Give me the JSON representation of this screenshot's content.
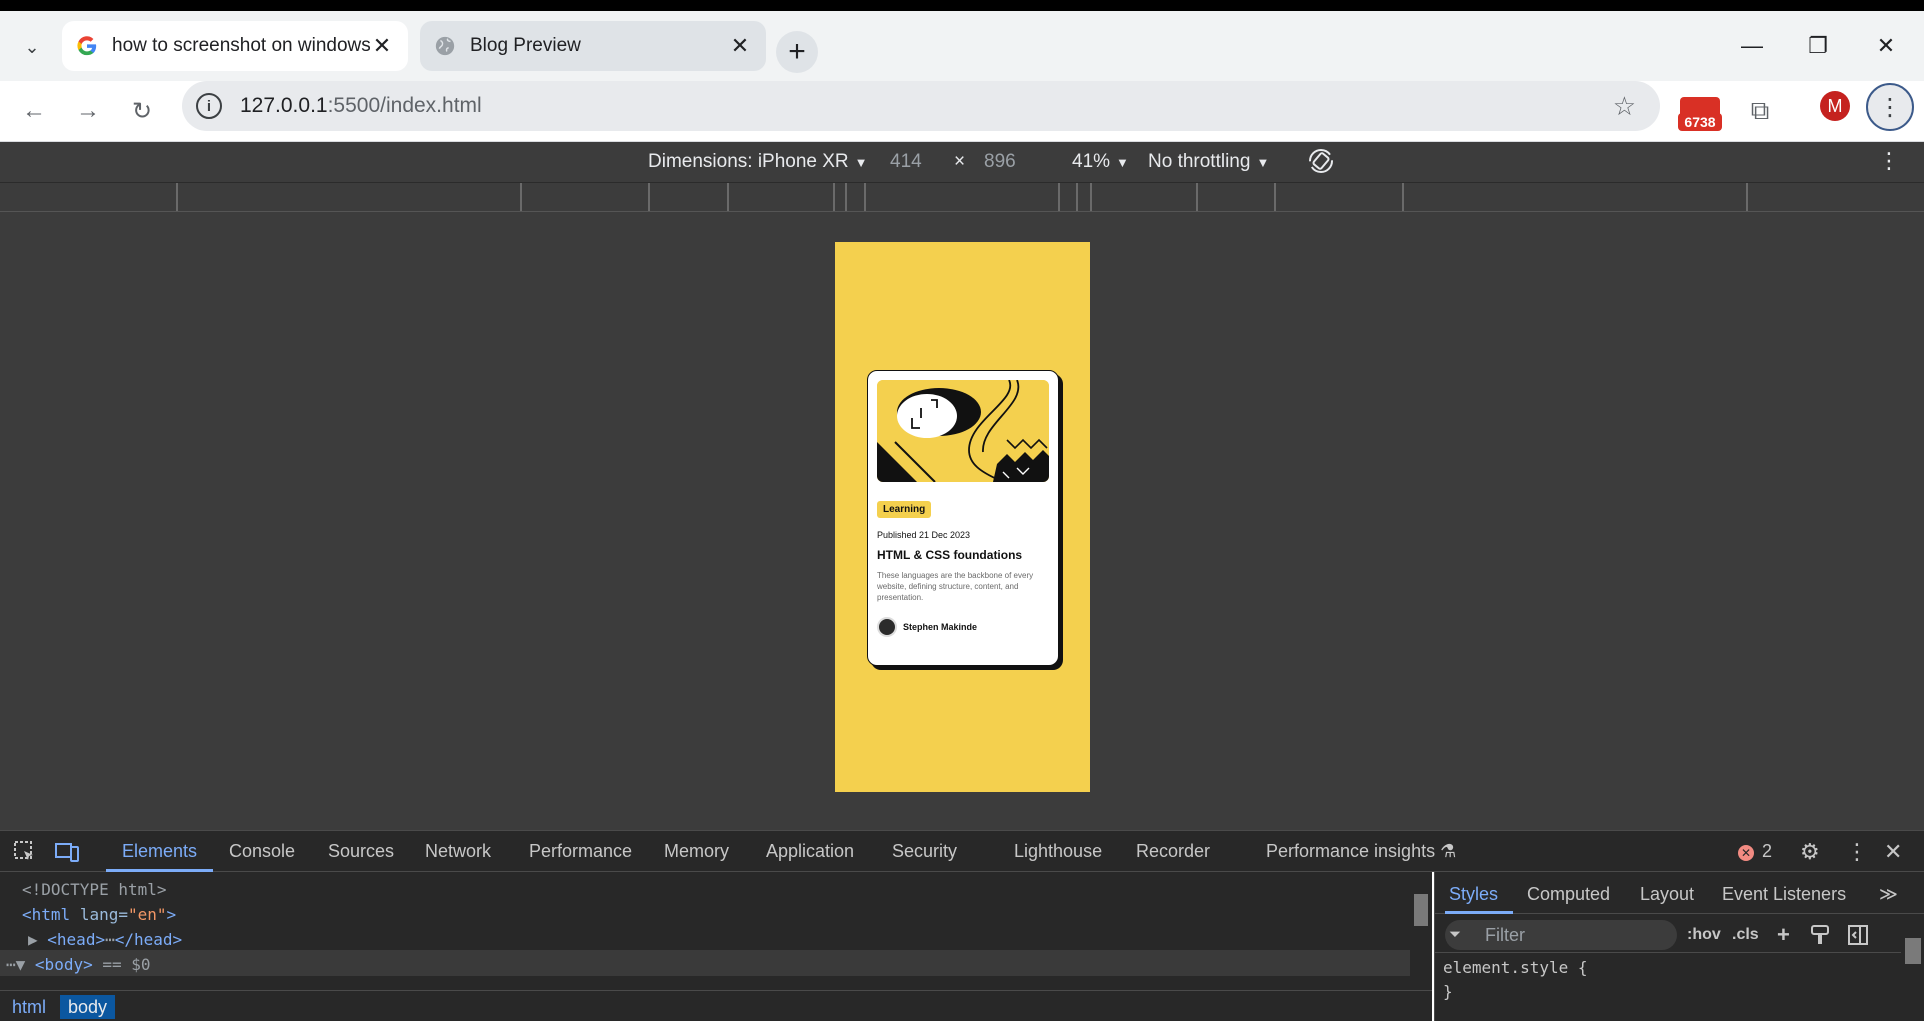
{
  "tabs": [
    {
      "title": "how to screenshot on windows",
      "close": "✕",
      "active": false
    },
    {
      "title": "Blog Preview",
      "close": "✕",
      "active": true
    }
  ],
  "tab_search_icon": "⌄",
  "new_tab_label": "+",
  "window_controls": {
    "minimize": "—",
    "restore": "❐",
    "close": "✕"
  },
  "nav": {
    "back": "←",
    "forward": "→",
    "reload": "↻"
  },
  "address": {
    "host": "127.0.0.1",
    "path": ":5500/index.html",
    "info_icon": "i",
    "star": "☆"
  },
  "extensions": {
    "badge_count": "6738",
    "puzzle": "⧉"
  },
  "profile": {
    "initial": "M"
  },
  "menu_icon": "⋮",
  "device_toolbar": {
    "dimensions_label": "Dimensions: iPhone XR",
    "width": "414",
    "times": "×",
    "height": "896",
    "zoom": "41%",
    "throttling": "No throttling",
    "caret": "▼",
    "kebab": "⋮"
  },
  "card": {
    "tag": "Learning",
    "date": "Published 21 Dec 2023",
    "title": "HTML & CSS foundations",
    "description": "These languages are the backbone of every website, defining structure, content, and presentation.",
    "author": "Stephen Makinde"
  },
  "devtools": {
    "tabs": [
      "Elements",
      "Console",
      "Sources",
      "Network",
      "Performance",
      "Memory",
      "Application",
      "Security",
      "Lighthouse",
      "Recorder",
      "Performance insights"
    ],
    "active_tab": "Elements",
    "error_count": "2",
    "error_icon": "✕",
    "lab_icon": "⚗",
    "settings_icon": "⚙",
    "more_icon": "⋮",
    "close_icon": "✕",
    "elements_lines": {
      "doctype": "<!DOCTYPE html>",
      "html_open": "<html",
      "html_attr": "lang=",
      "html_val": "\"en\"",
      "html_close": ">",
      "head": "<head>",
      "head_dots": "⋯",
      "head_close": "</head>",
      "body": "<body>",
      "body_eq": "== $0",
      "ellipsis": "⋯",
      "expand_closed": "▶",
      "expand_open": "▼"
    },
    "breadcrumbs": [
      "html",
      "body"
    ],
    "styles": {
      "tabs": [
        "Styles",
        "Computed",
        "Layout",
        "Event Listeners"
      ],
      "more": "≫",
      "filter_placeholder": "Filter",
      "filter_icon": "⏷",
      "hov": ":hov",
      "cls": ".cls",
      "plus": "+",
      "rule_selector": "element.style {",
      "rule_close": "}"
    }
  },
  "colors": {
    "phone_bg": "#f4d04e",
    "devtools_accent": "#7cacf8",
    "extension_badge": "#d93025"
  }
}
